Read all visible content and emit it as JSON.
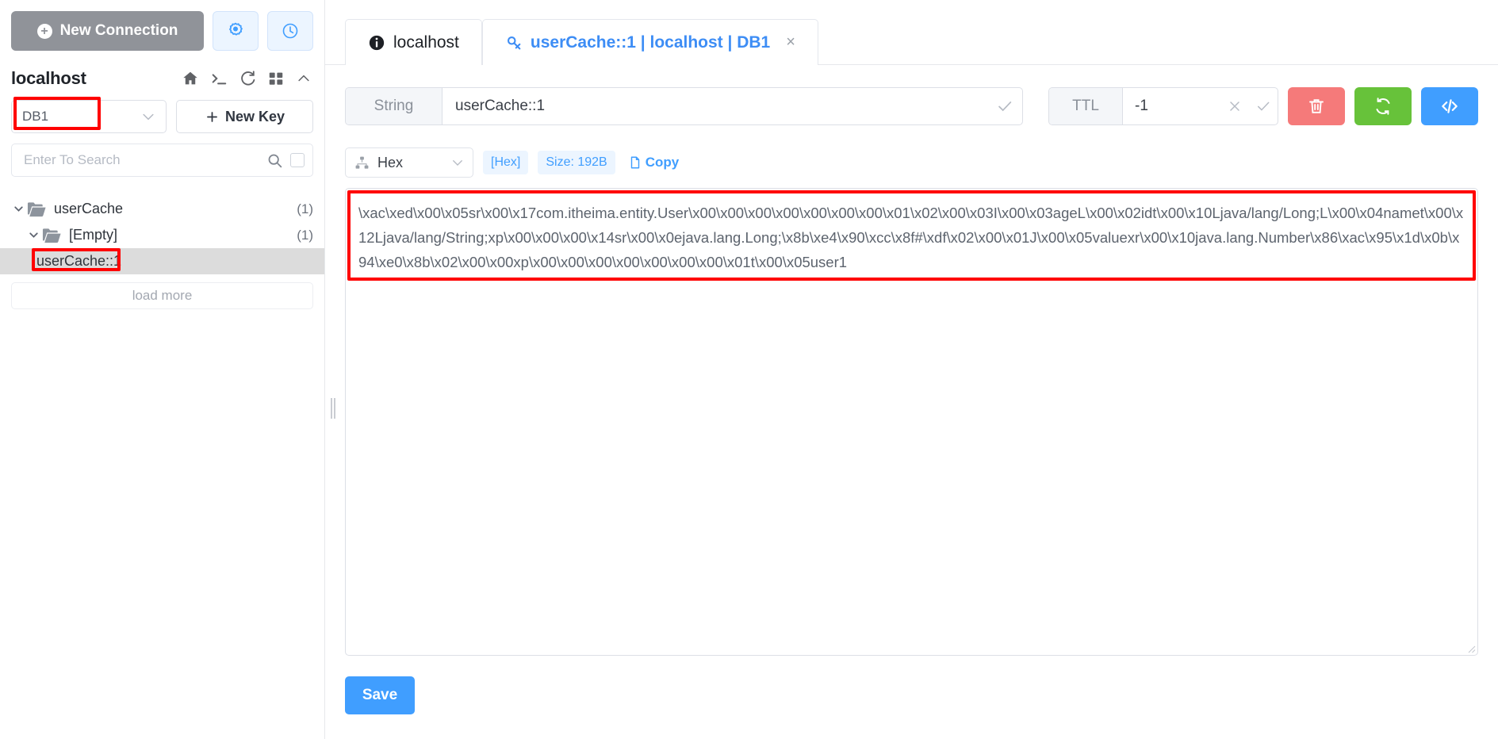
{
  "sidebar": {
    "new_connection_label": "New Connection",
    "icon_buttons": [
      {
        "name": "settings-icon",
        "title": "Settings"
      },
      {
        "name": "history-icon",
        "title": "History"
      }
    ],
    "host_title": "localhost",
    "host_tool_icons": [
      "home-icon",
      "terminal-icon",
      "refresh-icon",
      "grid-icon",
      "chevron-up-icon"
    ],
    "db_selector": {
      "value": "DB1",
      "highlighted": true
    },
    "new_key_label": "New Key",
    "search": {
      "placeholder": "Enter To Search",
      "value": ""
    },
    "tree": [
      {
        "label": "userCache",
        "count": "(1)",
        "type": "folder",
        "depth": 1,
        "expanded": true,
        "selected": false
      },
      {
        "label": "[Empty]",
        "count": "(1)",
        "type": "folder",
        "depth": 2,
        "expanded": true,
        "selected": false
      },
      {
        "label": "userCache::1",
        "count": "",
        "type": "key",
        "depth": 3,
        "expanded": false,
        "selected": true,
        "highlighted": true
      }
    ],
    "load_more_label": "load more"
  },
  "tabs": [
    {
      "label": "localhost",
      "icon": "info-icon",
      "active": false,
      "closable": false
    },
    {
      "label": "userCache::1 | localhost | DB1",
      "icon": "key-icon",
      "active": true,
      "closable": true,
      "close_label": "×"
    }
  ],
  "key_panel": {
    "type_tag": "String",
    "key_value": "userCache::1",
    "key_confirm_icon": "check-icon",
    "ttl_tag": "TTL",
    "ttl_value": "-1",
    "ttl_clear_icon": "close-icon",
    "ttl_confirm_icon": "check-icon",
    "actions": [
      {
        "name": "delete-key-button",
        "icon": "trash-icon",
        "color": "#f57a7a"
      },
      {
        "name": "refresh-key-button",
        "icon": "refresh-icon",
        "color": "#67c23a"
      },
      {
        "name": "view-code-button",
        "icon": "code-icon",
        "color": "#409eff"
      }
    ]
  },
  "format_bar": {
    "viewer_icon": "sitemap-icon",
    "format_value": "Hex",
    "detected_badge": "[Hex]",
    "size_badge": "Size: 192B",
    "copy_label": "Copy",
    "copy_icon": "document-icon"
  },
  "value_editor": {
    "content": "\\xac\\xed\\x00\\x05sr\\x00\\x17com.itheima.entity.User\\x00\\x00\\x00\\x00\\x00\\x00\\x00\\x01\\x02\\x00\\x03I\\x00\\x03ageL\\x00\\x02idt\\x00\\x10Ljava/lang/Long;L\\x00\\x04namet\\x00\\x12Ljava/lang/String;xp\\x00\\x00\\x00\\x14sr\\x00\\x0ejava.lang.Long;\\x8b\\xe4\\x90\\xcc\\x8f#\\xdf\\x02\\x00\\x01J\\x00\\x05valuexr\\x00\\x10java.lang.Number\\x86\\xac\\x95\\x1d\\x0b\\x94\\xe0\\x8b\\x02\\x00\\x00xp\\x00\\x00\\x00\\x00\\x00\\x00\\x00\\x01t\\x00\\x05user1",
    "highlighted": true
  },
  "save_button_label": "Save",
  "colors": {
    "accent": "#409eff",
    "danger": "#f57a7a",
    "success": "#67c23a",
    "neutral": "#909399",
    "highlight": "#ff0000",
    "selected_row": "#dcdcdc"
  }
}
